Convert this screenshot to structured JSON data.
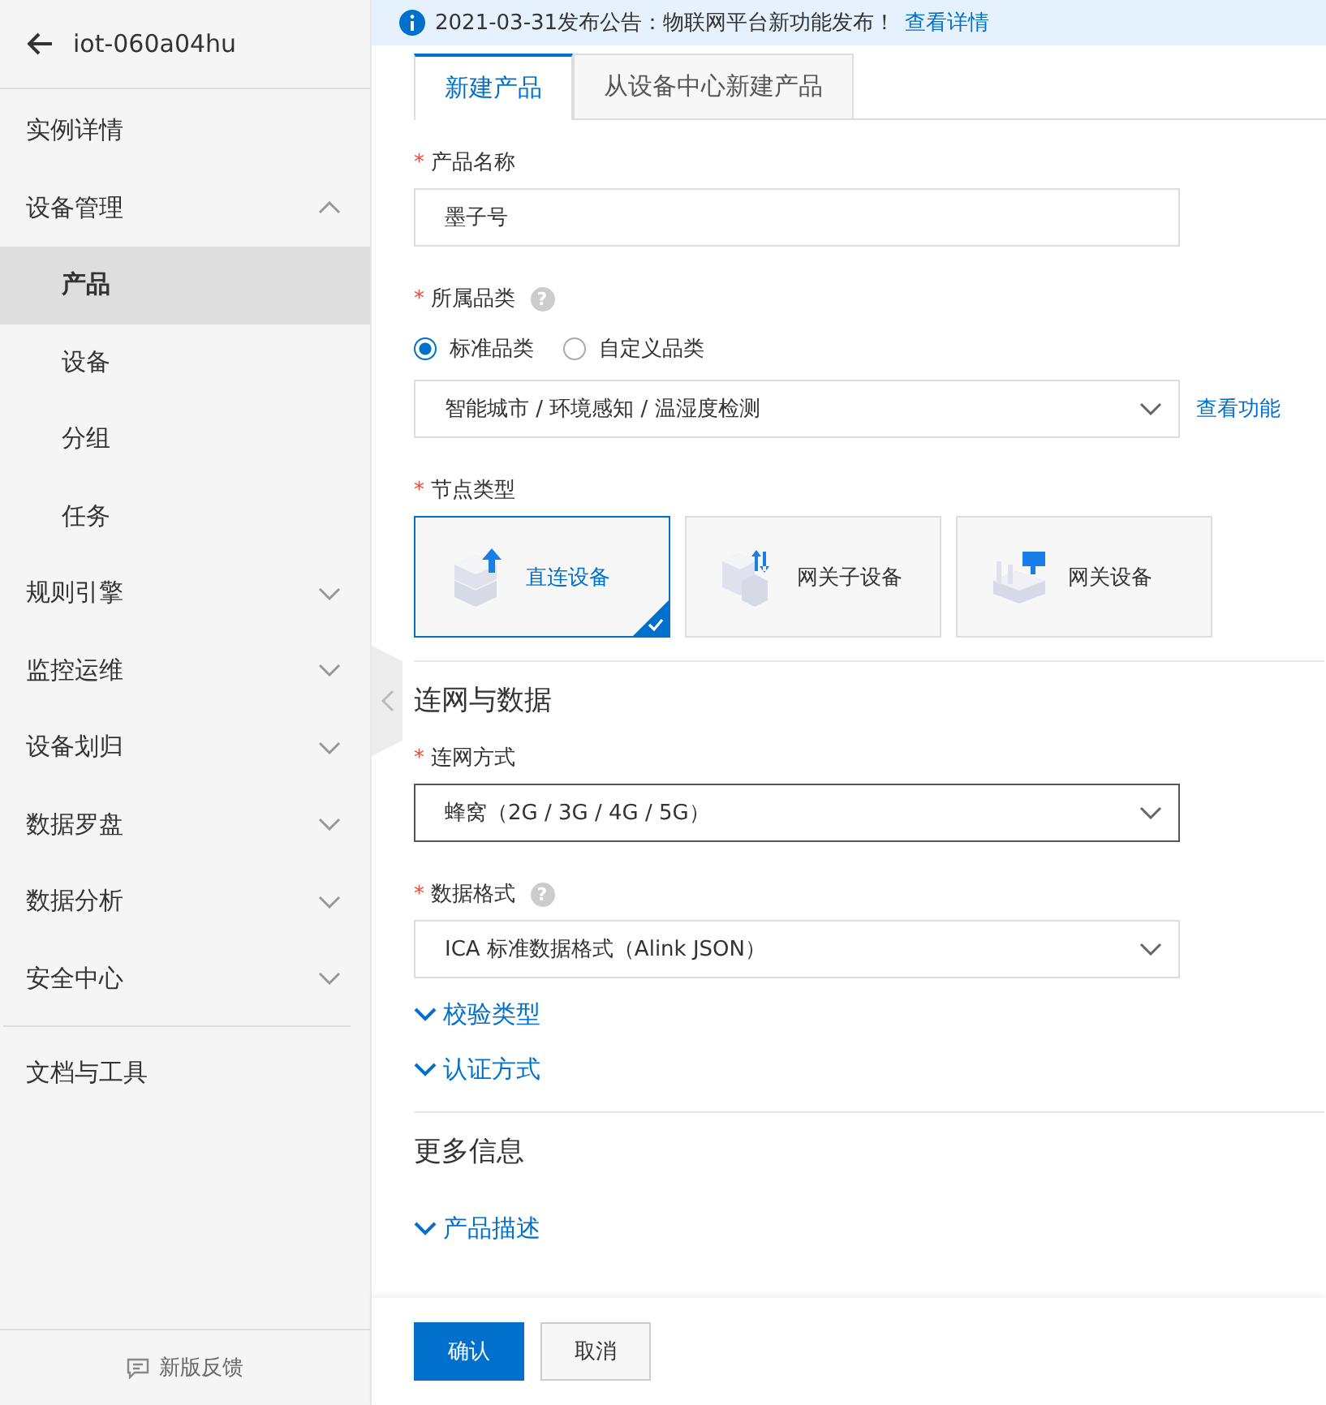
{
  "sidebar": {
    "title": "iot-060a04hu",
    "items": [
      {
        "label": "实例详情",
        "kind": "link"
      },
      {
        "label": "设备管理",
        "kind": "group",
        "expanded": true,
        "children": [
          {
            "label": "产品",
            "selected": true
          },
          {
            "label": "设备",
            "selected": false
          },
          {
            "label": "分组",
            "selected": false
          },
          {
            "label": "任务",
            "selected": false
          }
        ]
      },
      {
        "label": "规则引擎",
        "kind": "group",
        "expanded": false
      },
      {
        "label": "监控运维",
        "kind": "group",
        "expanded": false
      },
      {
        "label": "设备划归",
        "kind": "group",
        "expanded": false
      },
      {
        "label": "数据罗盘",
        "kind": "group",
        "expanded": false
      },
      {
        "label": "数据分析",
        "kind": "group",
        "expanded": false
      },
      {
        "label": "安全中心",
        "kind": "group",
        "expanded": false
      }
    ],
    "extra_items": [
      {
        "label": "文档与工具"
      }
    ],
    "feedback": "新版反馈"
  },
  "notice": {
    "text": "2021-03-31发布公告：物联网平台新功能发布！",
    "link": "查看详情"
  },
  "tabs": [
    {
      "label": "新建产品",
      "selected": true
    },
    {
      "label": "从设备中心新建产品",
      "selected": false
    }
  ],
  "product_name": {
    "label": "产品名称",
    "required_mark": "*",
    "value": "墨子号"
  },
  "category": {
    "label": "所属品类",
    "required_mark": "*",
    "help": "?",
    "options": [
      {
        "label": "标准品类",
        "selected": true
      },
      {
        "label": "自定义品类",
        "selected": false
      }
    ],
    "value": "智能城市 / 环境感知 / 温湿度检测",
    "link": "查看功能"
  },
  "node_type": {
    "label": "节点类型",
    "required_mark": "*",
    "options": [
      {
        "label": "直连设备",
        "kind": "direct",
        "selected": true
      },
      {
        "label": "网关子设备",
        "kind": "sub",
        "selected": false
      },
      {
        "label": "网关设备",
        "kind": "gateway",
        "selected": false
      }
    ]
  },
  "network_section": {
    "title": "连网与数据",
    "network": {
      "label": "连网方式",
      "required_mark": "*",
      "focused": true,
      "value": "蜂窝（2G / 3G / 4G / 5G）"
    },
    "data_format": {
      "label": "数据格式",
      "required_mark": "*",
      "help": "?",
      "focused": false,
      "value": "ICA 标准数据格式（Alink JSON）"
    },
    "collapsibles": [
      "校验类型",
      "认证方式"
    ]
  },
  "more_section": {
    "title": "更多信息",
    "collapsibles": [
      "产品描述"
    ]
  },
  "buttons": [
    {
      "label": "确认",
      "kind": "primary"
    },
    {
      "label": "取消",
      "kind": "default"
    }
  ]
}
